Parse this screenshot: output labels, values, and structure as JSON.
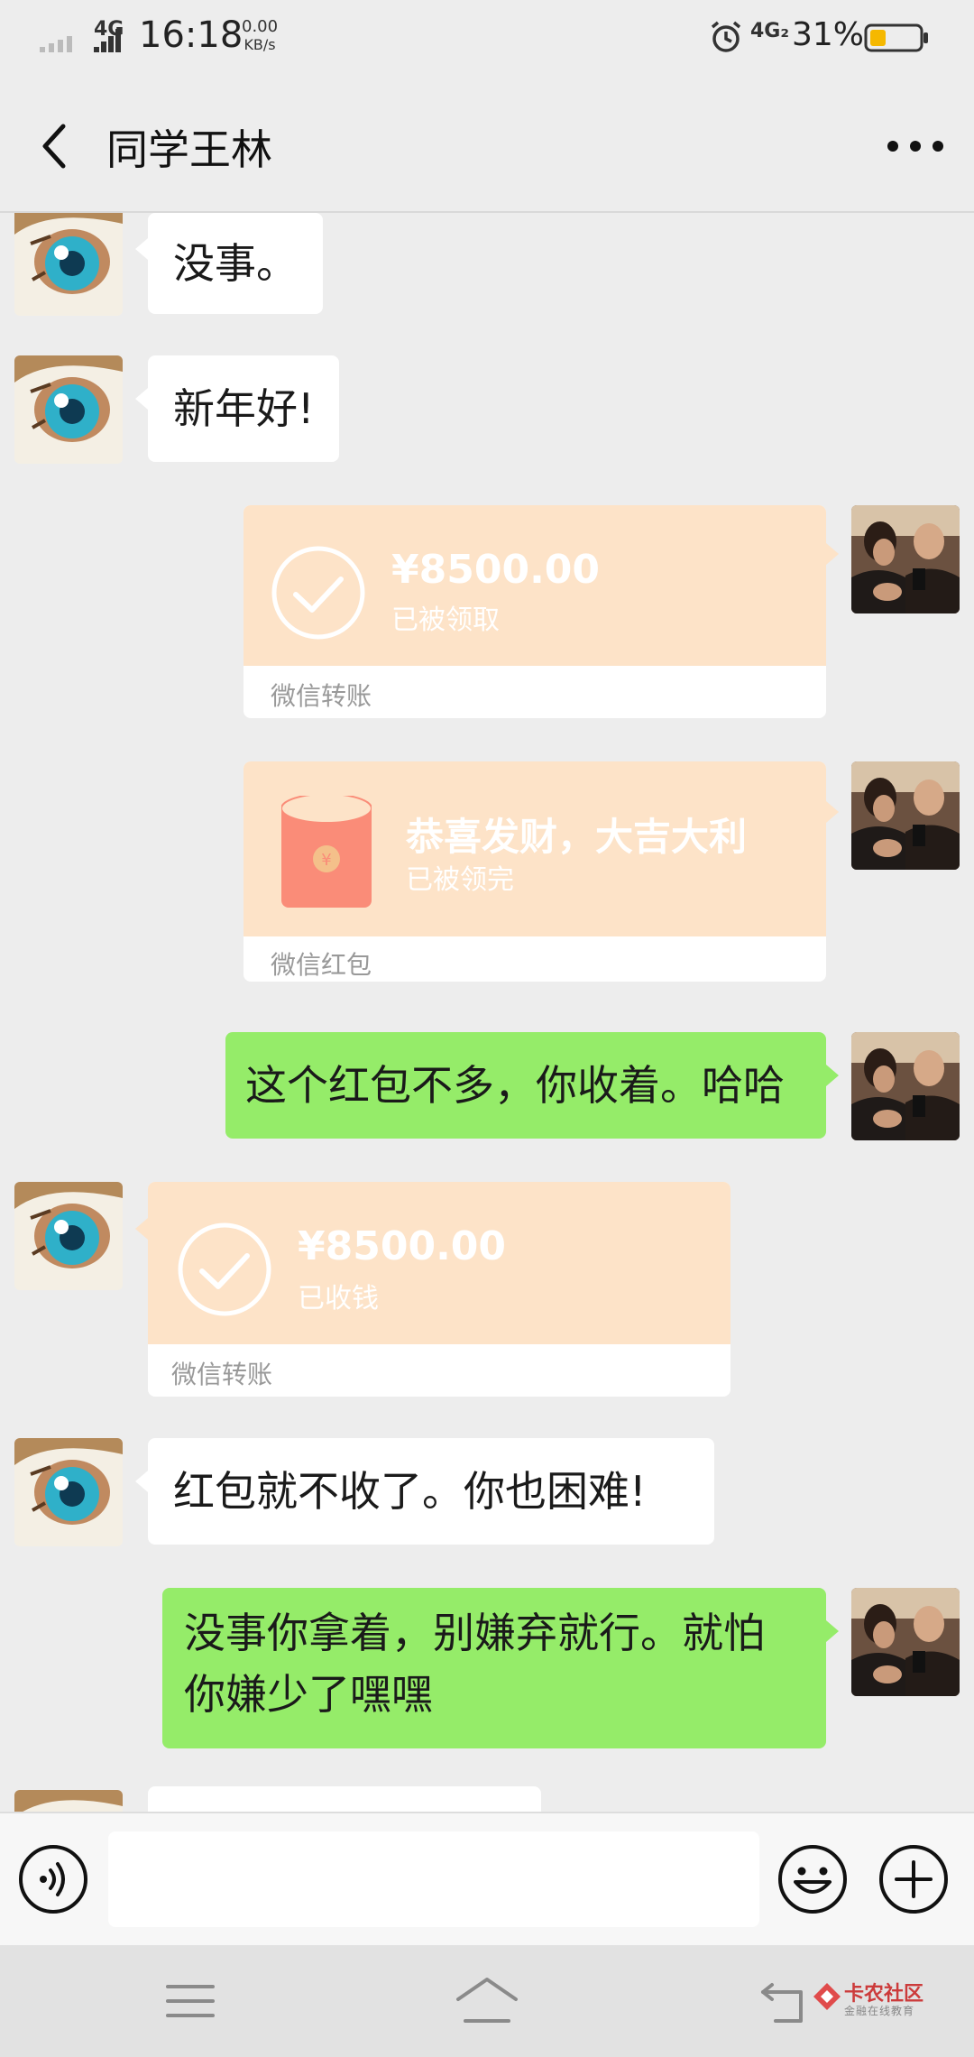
{
  "status_bar": {
    "network": "4G",
    "time": "16:18",
    "speed_value": "0.00",
    "speed_unit": "KB/s",
    "network2": "4G₂",
    "battery_percent": "31%",
    "battery_level": 0.31,
    "battery_color": "#f5b800",
    "icons": [
      "signal-icon",
      "alarm-icon",
      "battery-icon"
    ]
  },
  "header": {
    "title": "同学王林",
    "icons": [
      "back-arrow-icon",
      "more-icon"
    ]
  },
  "messages": [
    {
      "side": "left",
      "type": "text",
      "text": "没事。"
    },
    {
      "side": "left",
      "type": "text",
      "text": "新年好!"
    },
    {
      "side": "right",
      "type": "transfer",
      "amount": "¥8500.00",
      "status": "已被领取",
      "footer": "微信转账"
    },
    {
      "side": "right",
      "type": "red_packet",
      "title": "恭喜发财，大吉大利",
      "status": "已被领完",
      "footer": "微信红包"
    },
    {
      "side": "right",
      "type": "text",
      "text": "这个红包不多，你收着。哈哈"
    },
    {
      "side": "left",
      "type": "transfer",
      "amount": "¥8500.00",
      "status": "已收钱",
      "footer": "微信转账"
    },
    {
      "side": "left",
      "type": "text",
      "text": "红包就不收了。你也困难!"
    },
    {
      "side": "right",
      "type": "text",
      "line1": "没事你拿着，别嫌弃就行。就怕",
      "line2": "你嫌少了嘿嘿"
    }
  ],
  "colors": {
    "chat_bg": "#ededed",
    "bubble_green": "#95ec69",
    "card_peach": "#fde3c8",
    "red_packet": "#fa8c78"
  },
  "input_bar": {
    "placeholder": "",
    "icons": [
      "voice-icon",
      "emoji-icon",
      "plus-icon"
    ]
  },
  "nav_bar": {
    "icons": [
      "menu-icon",
      "home-icon",
      "back-icon"
    ]
  },
  "watermark": {
    "title": "卡农社区",
    "subtitle": "金融在线教育"
  }
}
